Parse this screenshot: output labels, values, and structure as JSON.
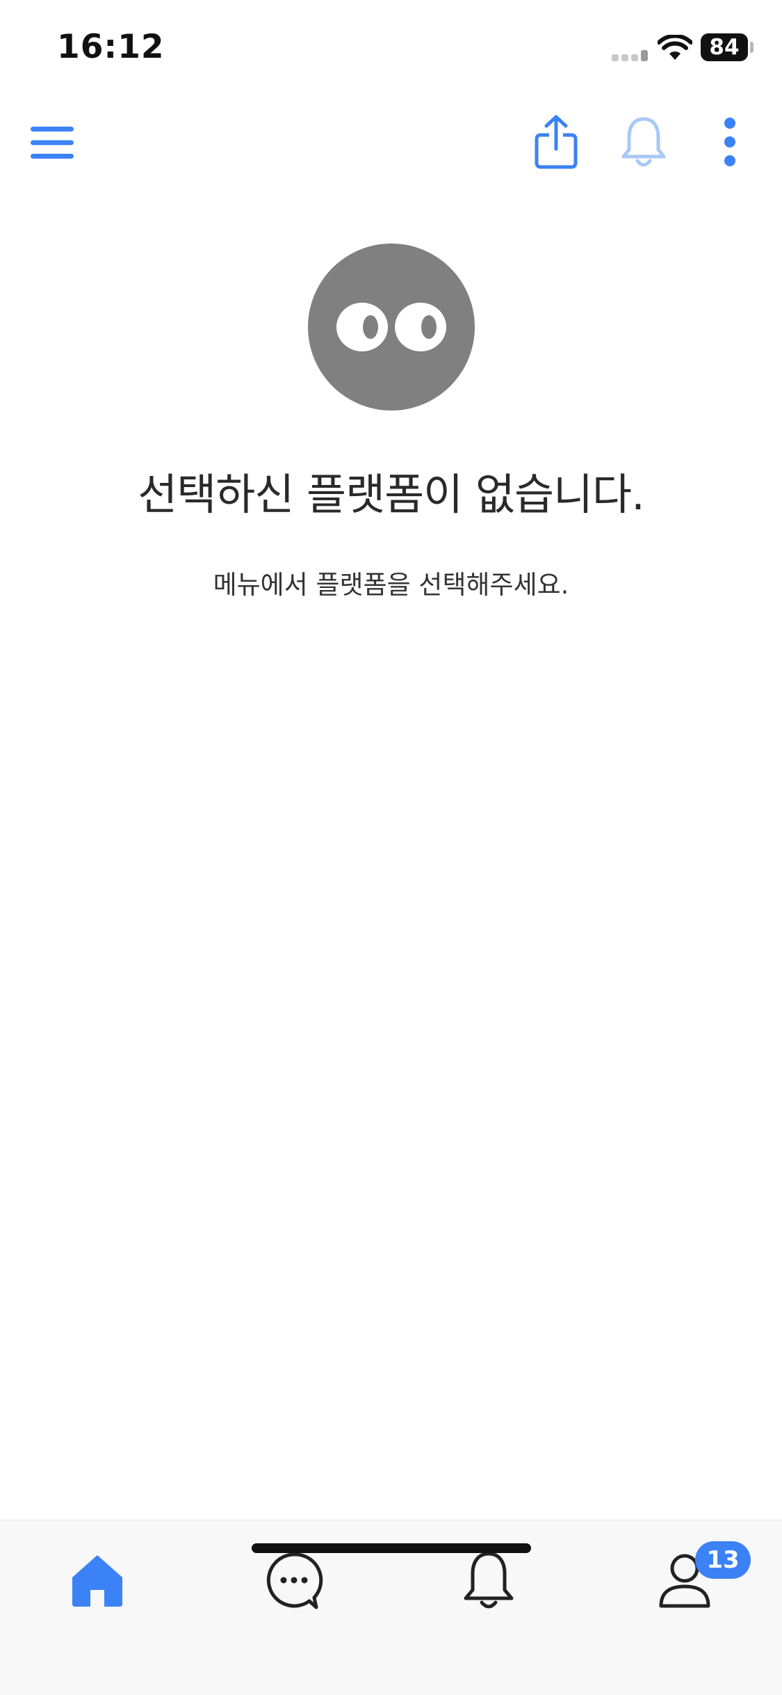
{
  "status_bar": {
    "time": "16:12",
    "battery": "84"
  },
  "top_bar": {
    "icons": [
      "hamburger-menu-icon",
      "share-icon",
      "bell-icon",
      "more-vertical-icon"
    ]
  },
  "empty_state": {
    "icon": "eyes-face-icon",
    "title": "선택하신 플랫폼이 없습니다.",
    "subtitle": "메뉴에서 플랫폼을 선택해주세요."
  },
  "tab_bar": {
    "tabs": [
      "home-icon",
      "chat-icon",
      "bell-icon",
      "profile-icon"
    ],
    "profile_badge": "13"
  },
  "colors": {
    "accent": "#3b82f6",
    "accent_light": "#a9c8f5",
    "empty_icon": "#808080",
    "text": "#2a2a2a"
  }
}
